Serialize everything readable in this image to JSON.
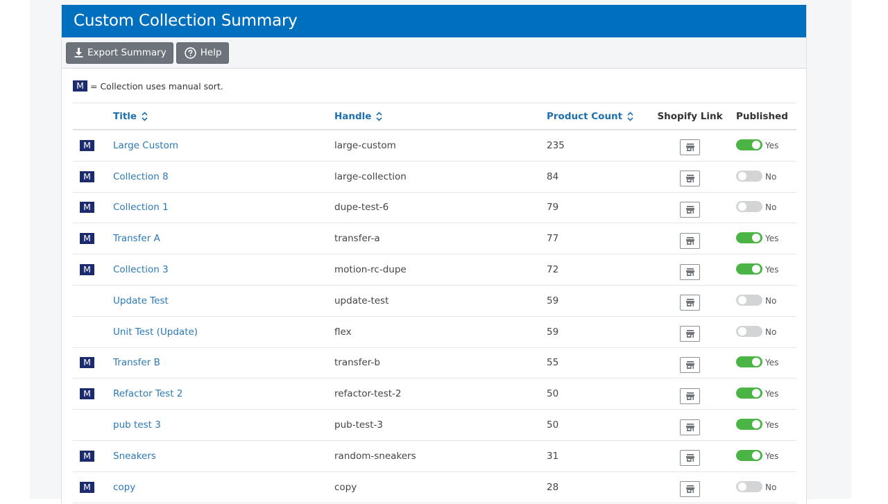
{
  "header": {
    "title": "Custom Collection Summary"
  },
  "toolbar": {
    "export_label": "Export Summary",
    "help_label": "Help"
  },
  "legend": {
    "badge": "M",
    "text": "= Collection uses manual sort."
  },
  "table": {
    "columns": {
      "title": "Title",
      "handle": "Handle",
      "product_count": "Product Count",
      "shopify_link": "Shopify Link",
      "published": "Published"
    },
    "badge_label": "M",
    "rows": [
      {
        "manual": true,
        "title": "Large Custom",
        "handle": "large-custom",
        "count": "235",
        "published": true,
        "published_label": "Yes"
      },
      {
        "manual": true,
        "title": "Collection 8",
        "handle": "large-collection",
        "count": "84",
        "published": false,
        "published_label": "No"
      },
      {
        "manual": true,
        "title": "Collection 1",
        "handle": "dupe-test-6",
        "count": "79",
        "published": false,
        "published_label": "No"
      },
      {
        "manual": true,
        "title": "Transfer A",
        "handle": "transfer-a",
        "count": "77",
        "published": true,
        "published_label": "Yes"
      },
      {
        "manual": true,
        "title": "Collection 3",
        "handle": "motion-rc-dupe",
        "count": "72",
        "published": true,
        "published_label": "Yes"
      },
      {
        "manual": false,
        "title": "Update Test",
        "handle": "update-test",
        "count": "59",
        "published": false,
        "published_label": "No"
      },
      {
        "manual": false,
        "title": "Unit Test (Update)",
        "handle": "flex",
        "count": "59",
        "published": false,
        "published_label": "No"
      },
      {
        "manual": true,
        "title": "Transfer B",
        "handle": "transfer-b",
        "count": "55",
        "published": true,
        "published_label": "Yes"
      },
      {
        "manual": true,
        "title": "Refactor Test 2",
        "handle": "refactor-test-2",
        "count": "50",
        "published": true,
        "published_label": "Yes"
      },
      {
        "manual": false,
        "title": "pub test 3",
        "handle": "pub-test-3",
        "count": "50",
        "published": true,
        "published_label": "Yes"
      },
      {
        "manual": true,
        "title": "Sneakers",
        "handle": "random-sneakers",
        "count": "31",
        "published": true,
        "published_label": "Yes"
      },
      {
        "manual": true,
        "title": "copy",
        "handle": "copy",
        "count": "28",
        "published": false,
        "published_label": "No"
      }
    ]
  },
  "icons": {
    "export": "download-icon",
    "help": "question-circle-icon",
    "sort": "sort-icon",
    "shopify_link": "store-icon"
  },
  "colors": {
    "header_bg": "#006fbe",
    "button_bg": "#6c737b",
    "manual_badge_bg": "#1c2a6e",
    "link_color": "#2b78b6",
    "toggle_on": "#4ab544",
    "toggle_off": "#d2d4d6"
  }
}
